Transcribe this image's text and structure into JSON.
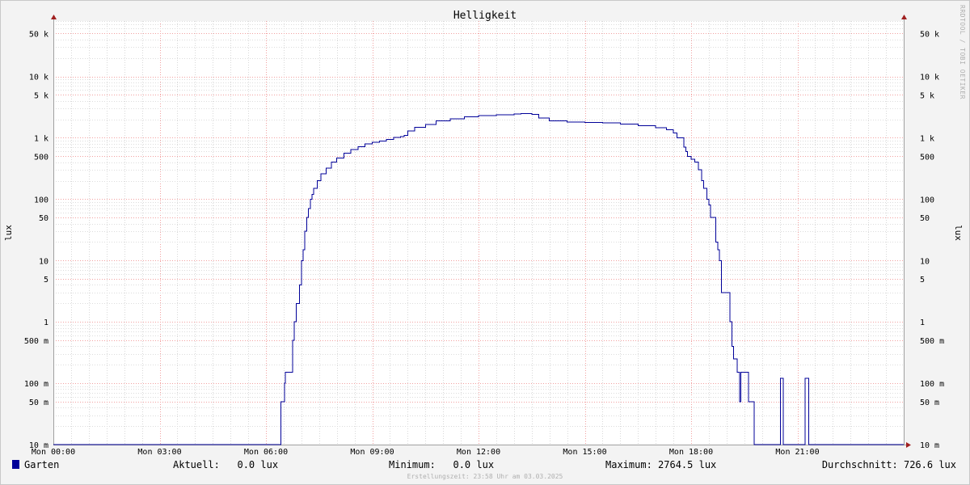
{
  "chart_data": {
    "type": "line",
    "title": "Helligkeit",
    "ylabel_left": "lux",
    "ylabel_right": "lux",
    "yscale": "log",
    "ylim": [
      0.01,
      80000
    ],
    "xlim_hours": [
      0,
      24
    ],
    "grid": true,
    "watermark": "RRDTOOL / TOBI OETIKER",
    "x_ticks": [
      {
        "h": 0,
        "label": "Mon 00:00"
      },
      {
        "h": 3,
        "label": "Mon 03:00"
      },
      {
        "h": 6,
        "label": "Mon 06:00"
      },
      {
        "h": 9,
        "label": "Mon 09:00"
      },
      {
        "h": 12,
        "label": "Mon 12:00"
      },
      {
        "h": 15,
        "label": "Mon 15:00"
      },
      {
        "h": 18,
        "label": "Mon 18:00"
      },
      {
        "h": 21,
        "label": "Mon 21:00"
      }
    ],
    "y_ticks": [
      {
        "v": 50000,
        "label": "50 k"
      },
      {
        "v": 10000,
        "label": "10 k"
      },
      {
        "v": 5000,
        "label": "5 k"
      },
      {
        "v": 1000,
        "label": "1 k"
      },
      {
        "v": 500,
        "label": "500"
      },
      {
        "v": 100,
        "label": "100"
      },
      {
        "v": 50,
        "label": "50"
      },
      {
        "v": 10,
        "label": "10"
      },
      {
        "v": 5,
        "label": "5"
      },
      {
        "v": 1,
        "label": "1"
      },
      {
        "v": 0.5,
        "label": "500 m"
      },
      {
        "v": 0.1,
        "label": "100 m"
      },
      {
        "v": 0.05,
        "label": "50 m"
      },
      {
        "v": 0.01,
        "label": "10 m"
      }
    ],
    "series": [
      {
        "name": "Garten",
        "color": "#000099",
        "points": [
          [
            0,
            0.01
          ],
          [
            6.4,
            0.01
          ],
          [
            6.42,
            0.05
          ],
          [
            6.5,
            0.05
          ],
          [
            6.52,
            0.1
          ],
          [
            6.55,
            0.15
          ],
          [
            6.7,
            0.15
          ],
          [
            6.75,
            0.5
          ],
          [
            6.8,
            1
          ],
          [
            6.85,
            2
          ],
          [
            6.9,
            2
          ],
          [
            6.95,
            4
          ],
          [
            7.0,
            10
          ],
          [
            7.05,
            15
          ],
          [
            7.1,
            30
          ],
          [
            7.15,
            50
          ],
          [
            7.2,
            70
          ],
          [
            7.25,
            100
          ],
          [
            7.3,
            120
          ],
          [
            7.35,
            150
          ],
          [
            7.45,
            200
          ],
          [
            7.55,
            260
          ],
          [
            7.7,
            320
          ],
          [
            7.85,
            400
          ],
          [
            8.0,
            470
          ],
          [
            8.2,
            560
          ],
          [
            8.4,
            640
          ],
          [
            8.6,
            720
          ],
          [
            8.8,
            790
          ],
          [
            9.0,
            840
          ],
          [
            9.2,
            890
          ],
          [
            9.4,
            940
          ],
          [
            9.6,
            1010
          ],
          [
            9.8,
            1040
          ],
          [
            9.9,
            1100
          ],
          [
            10.0,
            1300
          ],
          [
            10.2,
            1480
          ],
          [
            10.5,
            1650
          ],
          [
            10.8,
            1900
          ],
          [
            11.2,
            2050
          ],
          [
            11.6,
            2200
          ],
          [
            12.0,
            2300
          ],
          [
            12.5,
            2380
          ],
          [
            13.0,
            2450
          ],
          [
            13.2,
            2500
          ],
          [
            13.5,
            2400
          ],
          [
            13.7,
            2100
          ],
          [
            14.0,
            1900
          ],
          [
            14.5,
            1800
          ],
          [
            15.0,
            1780
          ],
          [
            15.5,
            1750
          ],
          [
            16.0,
            1680
          ],
          [
            16.5,
            1580
          ],
          [
            17.0,
            1450
          ],
          [
            17.3,
            1350
          ],
          [
            17.5,
            1200
          ],
          [
            17.6,
            1000
          ],
          [
            17.75,
            1000
          ],
          [
            17.8,
            700
          ],
          [
            17.85,
            600
          ],
          [
            17.9,
            500
          ],
          [
            18.0,
            450
          ],
          [
            18.1,
            400
          ],
          [
            18.2,
            300
          ],
          [
            18.3,
            200
          ],
          [
            18.35,
            150
          ],
          [
            18.45,
            100
          ],
          [
            18.5,
            80
          ],
          [
            18.55,
            50
          ],
          [
            18.65,
            50
          ],
          [
            18.7,
            20
          ],
          [
            18.75,
            15
          ],
          [
            18.8,
            10
          ],
          [
            18.85,
            3
          ],
          [
            19.05,
            3
          ],
          [
            19.1,
            1
          ],
          [
            19.15,
            0.4
          ],
          [
            19.2,
            0.25
          ],
          [
            19.3,
            0.15
          ],
          [
            19.35,
            0.15
          ],
          [
            19.37,
            0.05
          ],
          [
            19.4,
            0.15
          ],
          [
            19.6,
            0.15
          ],
          [
            19.62,
            0.05
          ],
          [
            19.75,
            0.05
          ],
          [
            19.78,
            0.01
          ],
          [
            20.5,
            0.01
          ],
          [
            20.52,
            0.12
          ],
          [
            20.58,
            0.12
          ],
          [
            20.6,
            0.01
          ],
          [
            21.2,
            0.01
          ],
          [
            21.22,
            0.12
          ],
          [
            21.3,
            0.12
          ],
          [
            21.32,
            0.01
          ],
          [
            24,
            0.01
          ]
        ]
      }
    ]
  },
  "legend": {
    "series_name": "Garten",
    "swatch_color": "#000099",
    "aktuell": "Aktuell:   0.0 lux",
    "minimum": "Minimum:   0.0 lux",
    "maximum": "Maximum: 2764.5 lux",
    "durchschnitt": "Durchschnitt: 726.6 lux"
  },
  "footer": "Erstellungszeit: 23:58 Uhr am 03.03.2025"
}
